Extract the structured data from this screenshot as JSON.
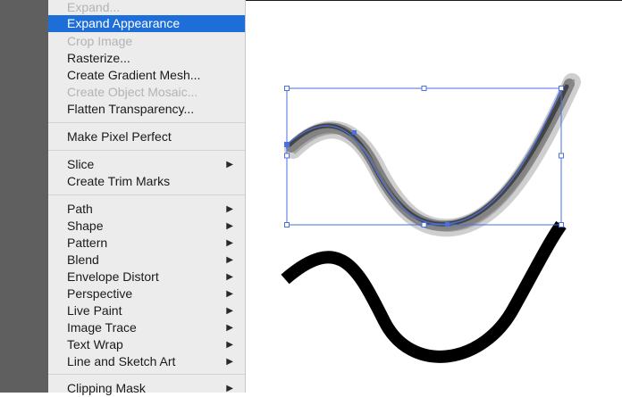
{
  "menu": {
    "items": [
      {
        "label": "Expand...",
        "disabled": true
      },
      {
        "label": "Expand Appearance",
        "selected": true
      },
      {
        "label": "Crop Image",
        "disabled": true
      },
      {
        "label": "Rasterize..."
      },
      {
        "label": "Create Gradient Mesh..."
      },
      {
        "label": "Create Object Mosaic...",
        "disabled": true
      },
      {
        "label": "Flatten Transparency..."
      },
      {
        "label": "Make Pixel Perfect"
      },
      {
        "label": "Slice",
        "submenu": true
      },
      {
        "label": "Create Trim Marks"
      },
      {
        "label": "Path",
        "submenu": true
      },
      {
        "label": "Shape",
        "submenu": true
      },
      {
        "label": "Pattern",
        "submenu": true
      },
      {
        "label": "Blend",
        "submenu": true
      },
      {
        "label": "Envelope Distort",
        "submenu": true
      },
      {
        "label": "Perspective",
        "submenu": true
      },
      {
        "label": "Live Paint",
        "submenu": true
      },
      {
        "label": "Image Trace",
        "submenu": true
      },
      {
        "label": "Text Wrap",
        "submenu": true
      },
      {
        "label": "Line and Sketch Art",
        "submenu": true
      },
      {
        "label": "Clipping Mask",
        "submenu": true
      }
    ],
    "submenu_arrow": "▶"
  },
  "colors": {
    "selection_blue": "#4a6fe0",
    "menu_highlight": "#1d6ed8",
    "stroke_black": "#000000"
  }
}
